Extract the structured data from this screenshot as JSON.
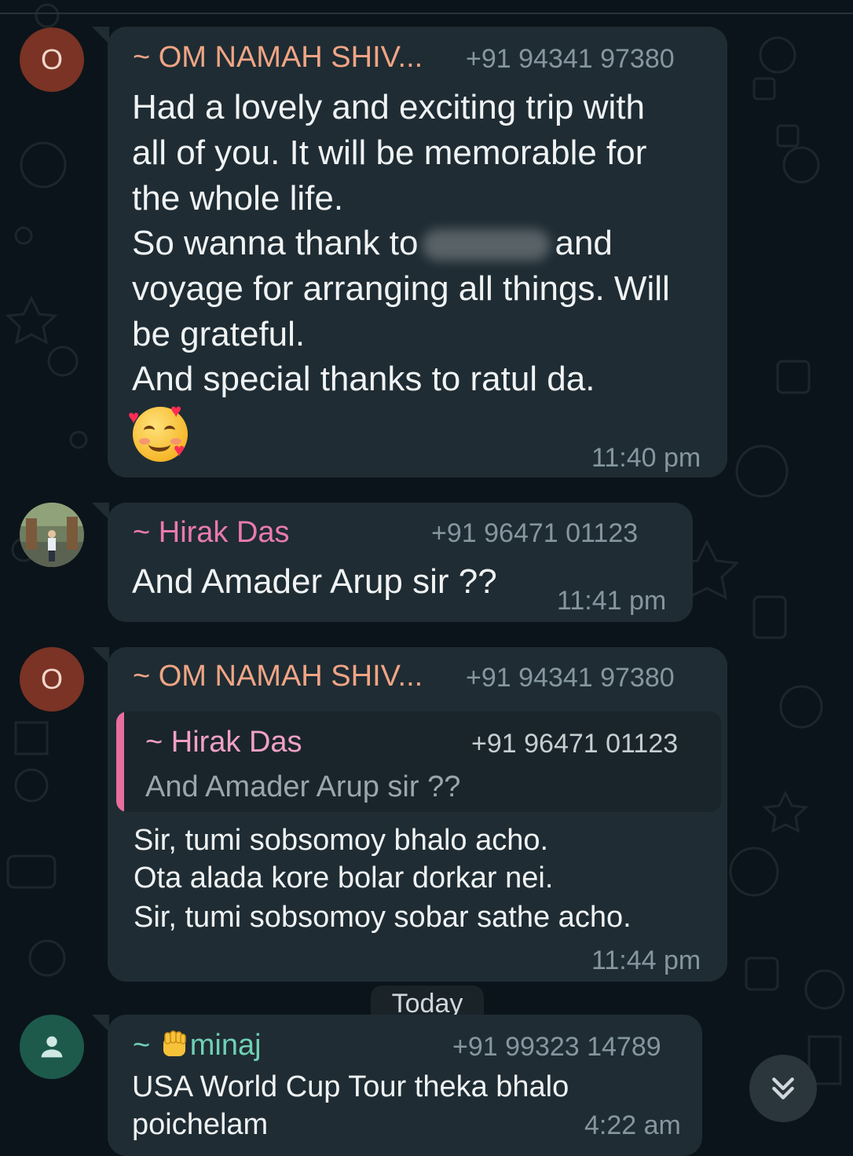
{
  "messages": [
    {
      "sender": "~ OM NAMAH SHIV...",
      "phone": "+91 94341 97380",
      "avatar_letter": "O",
      "lines": [
        "Had a lovely and exciting trip with",
        "all of you. It will be memorable for",
        "the whole life.",
        "So wanna thank to",
        "and",
        "voyage for arranging all things. Will",
        "be grateful.",
        "And special thanks to ratul da."
      ],
      "emoji": "smiling-face-with-hearts",
      "time": "11:40 pm"
    },
    {
      "sender": "~ Hirak Das",
      "phone": "+91 96471 01123",
      "text": "And Amader Arup sir ??",
      "time": "11:41 pm"
    },
    {
      "sender": "~ OM NAMAH SHIV...",
      "phone": "+91 94341 97380",
      "avatar_letter": "O",
      "quote": {
        "sender": "~ Hirak Das",
        "phone": "+91 96471 01123",
        "text": "And Amader Arup sir ??"
      },
      "lines": [
        "Sir, tumi sobsomoy bhalo acho.",
        "Ota alada kore bolar dorkar nei.",
        "Sir, tumi sobsomoy sobar sathe acho."
      ],
      "time": "11:44 pm"
    },
    {
      "sender_prefix": "~",
      "sender_emoji": "raised-fist",
      "sender": "minaj",
      "phone": "+91 99323 14789",
      "lines": [
        "USA World Cup Tour theka bhalo",
        "poichelam"
      ],
      "time": "4:22 am"
    }
  ],
  "date_divider": "Today",
  "colors": {
    "background": "#0b141a",
    "bubble": "#1f2c33",
    "om_name": "#f0a585",
    "hirak_name": "#e97ab0",
    "minaj_name": "#6fd0b6",
    "meta_text": "#8696a0"
  },
  "icons": {
    "scroll_down": "double-chevron-down-icon",
    "default_avatar": "person-icon"
  }
}
